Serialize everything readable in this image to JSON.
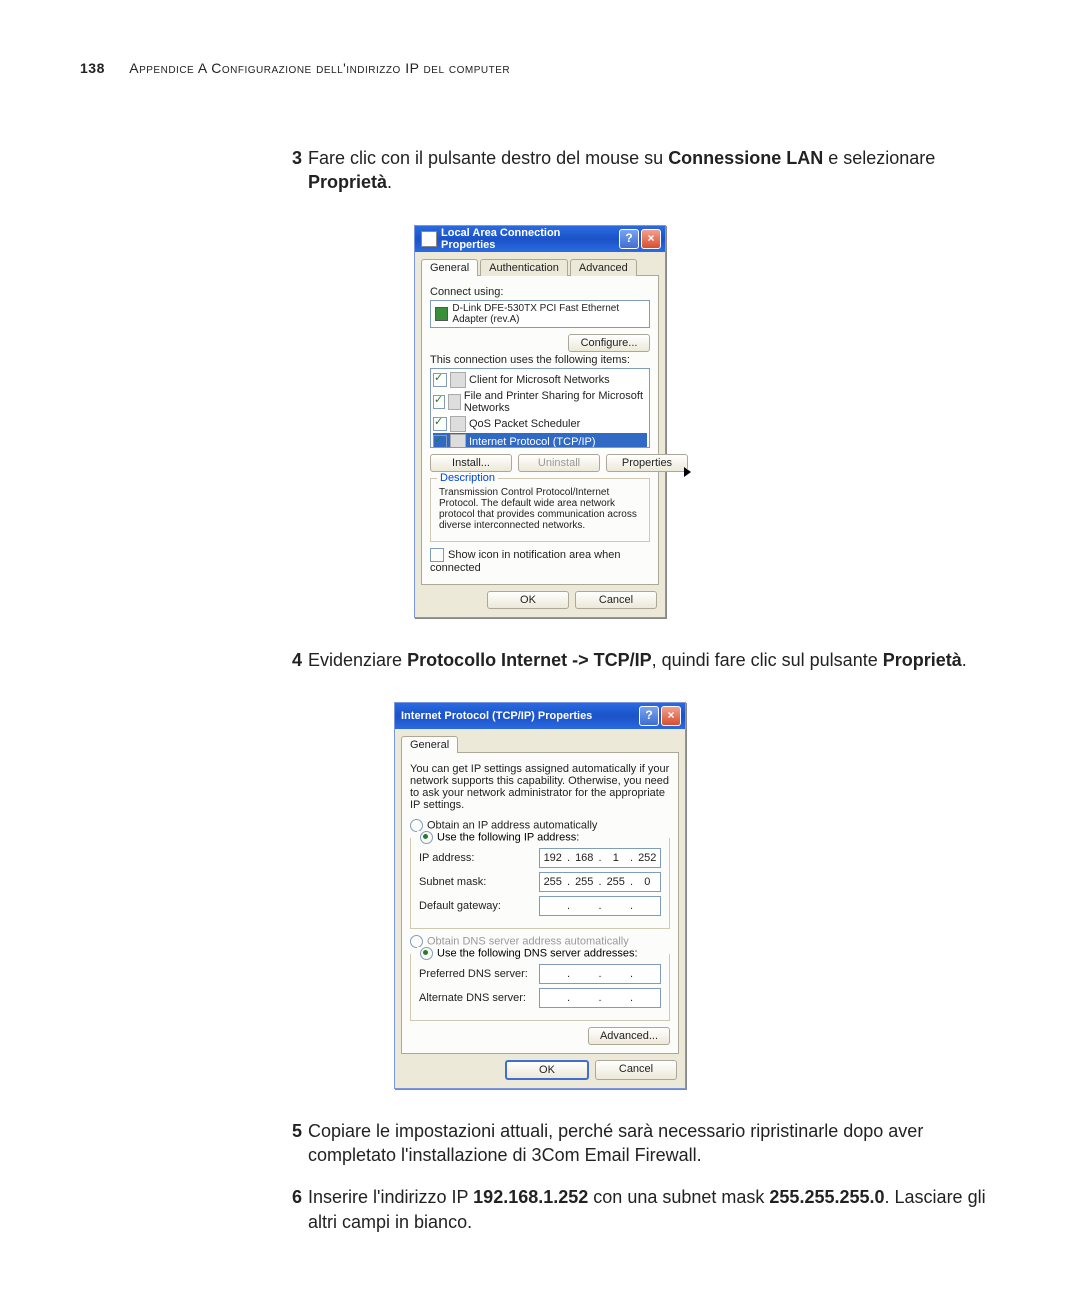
{
  "header": {
    "page_number": "138",
    "text": "Appendice A Configurazione dell'indirizzo IP del computer"
  },
  "steps": {
    "s3": {
      "num": "3",
      "pre": "Fare clic con il pulsante destro del mouse su ",
      "bold1": "Connessione LAN",
      "mid": " e selezionare ",
      "bold2": "Proprietà",
      "post": "."
    },
    "s4": {
      "num": "4",
      "pre": "Evidenziare ",
      "bold1": "Protocollo Internet -> TCP/IP",
      "mid": ", quindi fare clic sul pulsante ",
      "bold2": "Proprietà",
      "post": "."
    },
    "s5": {
      "num": "5",
      "text": "Copiare le impostazioni attuali, perché sarà necessario ripristinarle dopo aver completato l'installazione di 3Com Email Firewall."
    },
    "s6": {
      "num": "6",
      "pre": "Inserire l'indirizzo IP ",
      "bold1": "192.168.1.252",
      "mid": " con una subnet mask ",
      "bold2": "255.255.255.0",
      "post": ". Lasciare gli altri campi in bianco."
    }
  },
  "dialog1": {
    "title": "Local Area Connection Properties",
    "tabs": [
      "General",
      "Authentication",
      "Advanced"
    ],
    "connect_using_label": "Connect using:",
    "adapter": "D-Link DFE-530TX PCI Fast Ethernet Adapter (rev.A)",
    "configure_btn": "Configure...",
    "items_label": "This connection uses the following items:",
    "items": [
      "Client for Microsoft Networks",
      "File and Printer Sharing for Microsoft Networks",
      "QoS Packet Scheduler",
      "Internet Protocol (TCP/IP)"
    ],
    "install_btn": "Install...",
    "uninstall_btn": "Uninstall",
    "properties_btn": "Properties",
    "desc_legend": "Description",
    "desc_text": "Transmission Control Protocol/Internet Protocol. The default wide area network protocol that provides communication across diverse interconnected networks.",
    "show_icon": "Show icon in notification area when connected",
    "ok": "OK",
    "cancel": "Cancel"
  },
  "dialog2": {
    "title": "Internet Protocol (TCP/IP) Properties",
    "tab": "General",
    "intro": "You can get IP settings assigned automatically if your network supports this capability. Otherwise, you need to ask your network administrator for the appropriate IP settings.",
    "r_auto": "Obtain an IP address automatically",
    "r_manual": "Use the following IP address:",
    "ip_label": "IP address:",
    "ip": [
      "192",
      "168",
      "1",
      "252"
    ],
    "mask_label": "Subnet mask:",
    "mask": [
      "255",
      "255",
      "255",
      "0"
    ],
    "gw_label": "Default gateway:",
    "gw": [
      "",
      "",
      "",
      ""
    ],
    "r_dns_auto": "Obtain DNS server address automatically",
    "r_dns_manual": "Use the following DNS server addresses:",
    "pdns_label": "Preferred DNS server:",
    "adns_label": "Alternate DNS server:",
    "advanced_btn": "Advanced...",
    "ok": "OK",
    "cancel": "Cancel"
  }
}
